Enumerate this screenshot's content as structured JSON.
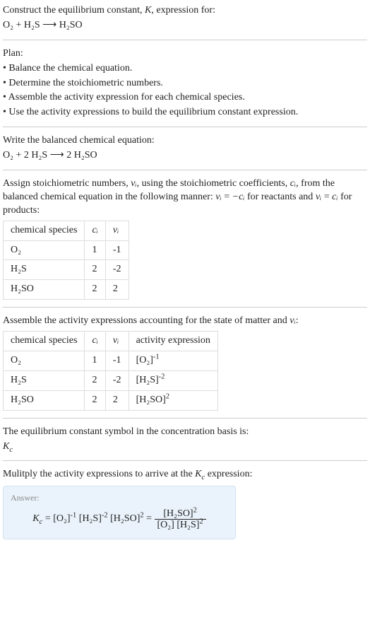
{
  "intro": {
    "line1": "Construct the equilibrium constant, K, expression for:",
    "equation_lhs": "O₂ + H₂S",
    "arrow": "⟶",
    "equation_rhs": "H₂SO"
  },
  "plan": {
    "title": "Plan:",
    "b1": "• Balance the chemical equation.",
    "b2": "• Determine the stoichiometric numbers.",
    "b3": "• Assemble the activity expression for each chemical species.",
    "b4": "• Use the activity expressions to build the equilibrium constant expression."
  },
  "balanced": {
    "title": "Write the balanced chemical equation:",
    "lhs": "O₂ + 2 H₂S",
    "arrow": "⟶",
    "rhs": "2 H₂SO"
  },
  "stoich": {
    "text_a": "Assign stoichiometric numbers, ",
    "text_b": ", using the stoichiometric coefficients, ",
    "text_c": ", from the balanced chemical equation in the following manner: ",
    "text_d": " for reactants and ",
    "text_e": " for products:",
    "nui": "νᵢ",
    "ci": "cᵢ",
    "eq1_l": "νᵢ",
    "eq1_r": "−cᵢ",
    "eq2_l": "νᵢ",
    "eq2_r": "cᵢ",
    "head_species": "chemical species",
    "head_ci": "cᵢ",
    "head_nui": "νᵢ",
    "rows": [
      {
        "s": "O₂",
        "c": "1",
        "n": "-1"
      },
      {
        "s": "H₂S",
        "c": "2",
        "n": "-2"
      },
      {
        "s": "H₂SO",
        "c": "2",
        "n": "2"
      }
    ]
  },
  "activity": {
    "title_a": "Assemble the activity expressions accounting for the state of matter and ",
    "title_b": ":",
    "nui": "νᵢ",
    "head_species": "chemical species",
    "head_ci": "cᵢ",
    "head_nui": "νᵢ",
    "head_act": "activity expression",
    "rows": [
      {
        "s": "O₂",
        "c": "1",
        "n": "-1",
        "base": "[O₂]",
        "exp": "-1"
      },
      {
        "s": "H₂S",
        "c": "2",
        "n": "-2",
        "base": "[H₂S]",
        "exp": "-2"
      },
      {
        "s": "H₂SO",
        "c": "2",
        "n": "2",
        "base": "[H₂SO]",
        "exp": "2"
      }
    ]
  },
  "kc_symbol": {
    "title": "The equilibrium constant symbol in the concentration basis is:",
    "sym": "K",
    "sub": "c"
  },
  "multiply": {
    "title_a": "Mulitply the activity expressions to arrive at the ",
    "title_b": " expression:",
    "ksym": "K",
    "ksub": "c"
  },
  "answer": {
    "label": "Answer:",
    "ksym": "K",
    "ksub": "c",
    "t1_base": "[O₂]",
    "t1_exp": "-1",
    "t2_base": "[H₂S]",
    "t2_exp": "-2",
    "t3_base": "[H₂SO]",
    "t3_exp": "2",
    "num_base": "[H₂SO]",
    "num_exp": "2",
    "den1_base": "[O₂]",
    "den2_base": "[H₂S]",
    "den2_exp": "2"
  }
}
